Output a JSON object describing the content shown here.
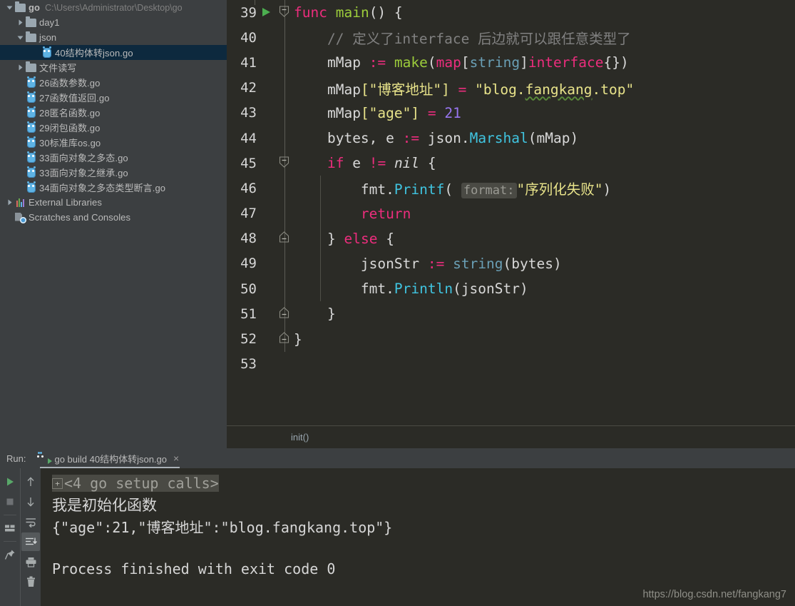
{
  "sidebar": {
    "items": [
      {
        "label": "go",
        "suffix": "C:\\Users\\Administrator\\Desktop\\go",
        "icon": "folder-icon",
        "arrow": "chevron-down-icon",
        "indent": 0,
        "bold": true,
        "selected": false
      },
      {
        "label": "day1",
        "suffix": "",
        "icon": "folder-icon",
        "arrow": "chevron-right-icon",
        "indent": 1,
        "bold": false,
        "selected": false
      },
      {
        "label": "json",
        "suffix": "",
        "icon": "folder-icon",
        "arrow": "chevron-down-icon",
        "indent": 1,
        "bold": false,
        "selected": false
      },
      {
        "label": "40结构体转json.go",
        "suffix": "",
        "icon": "go-file-icon",
        "arrow": "none",
        "indent": 2,
        "bold": false,
        "selected": true
      },
      {
        "label": "文件读写",
        "suffix": "",
        "icon": "folder-icon",
        "arrow": "chevron-right-icon",
        "indent": 1,
        "bold": false,
        "selected": false
      },
      {
        "label": "26函数参数.go",
        "suffix": "",
        "icon": "go-file-icon",
        "arrow": "none",
        "indent": 1,
        "bold": false,
        "selected": false
      },
      {
        "label": "27函数值返回.go",
        "suffix": "",
        "icon": "go-file-icon",
        "arrow": "none",
        "indent": 1,
        "bold": false,
        "selected": false
      },
      {
        "label": "28匿名函数.go",
        "suffix": "",
        "icon": "go-file-icon",
        "arrow": "none",
        "indent": 1,
        "bold": false,
        "selected": false
      },
      {
        "label": "29闭包函数.go",
        "suffix": "",
        "icon": "go-file-icon",
        "arrow": "none",
        "indent": 1,
        "bold": false,
        "selected": false
      },
      {
        "label": "30标准库os.go",
        "suffix": "",
        "icon": "go-file-icon",
        "arrow": "none",
        "indent": 1,
        "bold": false,
        "selected": false
      },
      {
        "label": "33面向对象之多态.go",
        "suffix": "",
        "icon": "go-file-icon",
        "arrow": "none",
        "indent": 1,
        "bold": false,
        "selected": false
      },
      {
        "label": "33面向对象之继承.go",
        "suffix": "",
        "icon": "go-file-icon",
        "arrow": "none",
        "indent": 1,
        "bold": false,
        "selected": false
      },
      {
        "label": "34面向对象之多态类型断言.go",
        "suffix": "",
        "icon": "go-file-icon",
        "arrow": "none",
        "indent": 1,
        "bold": false,
        "selected": false
      },
      {
        "label": "External Libraries",
        "suffix": "",
        "icon": "libraries-icon",
        "arrow": "chevron-right-icon",
        "indent": 0,
        "bold": false,
        "selected": false
      },
      {
        "label": "Scratches and Consoles",
        "suffix": "",
        "icon": "scratches-icon",
        "arrow": "none",
        "indent": 0,
        "bold": false,
        "selected": false
      }
    ]
  },
  "editor": {
    "breadcrumb": "init()",
    "first_line_number": 39,
    "lines": [
      {
        "n": "39",
        "gutter": "run-arrow-and-fold-collapse",
        "indent": 0
      },
      {
        "n": "40",
        "gutter": "none",
        "indent": 1
      },
      {
        "n": "41",
        "gutter": "none",
        "indent": 1
      },
      {
        "n": "42",
        "gutter": "none",
        "indent": 1
      },
      {
        "n": "43",
        "gutter": "none",
        "indent": 1
      },
      {
        "n": "44",
        "gutter": "none",
        "indent": 1
      },
      {
        "n": "45",
        "gutter": "fold-down",
        "indent": 1
      },
      {
        "n": "46",
        "gutter": "none",
        "indent": 2
      },
      {
        "n": "47",
        "gutter": "none",
        "indent": 2
      },
      {
        "n": "48",
        "gutter": "fold-up",
        "indent": 1
      },
      {
        "n": "49",
        "gutter": "none",
        "indent": 2
      },
      {
        "n": "50",
        "gutter": "none",
        "indent": 2
      },
      {
        "n": "51",
        "gutter": "fold-up",
        "indent": 1
      },
      {
        "n": "52",
        "gutter": "fold-up",
        "indent": 0
      },
      {
        "n": "53",
        "gutter": "none",
        "indent": 0
      }
    ],
    "code": {
      "l39_func": "func",
      "l39_name": "main",
      "l39_tail": "() {",
      "l40_comment": "// 定义了interface 后边就可以跟任意类型了",
      "l41_var": "mMap",
      "l41_assign": ":=",
      "l41_make": "make",
      "l41_open": "(",
      "l41_map": "map",
      "l41_lb": "[",
      "l41_string": "string",
      "l41_rb": "]",
      "l41_iface": "interface",
      "l41_close": "{})",
      "l42_var": "mMap",
      "l42_key": "[\"博客地址\"]",
      "l42_eq": "=",
      "l42_val_pre": "\"blog.",
      "l42_val_squig": "fangkang",
      "l42_val_post": ".top\"",
      "l43_var": "mMap",
      "l43_key": "[\"age\"]",
      "l43_eq": "=",
      "l43_num": "21",
      "l44_lhs": "bytes, e",
      "l44_assign": ":=",
      "l44_pkg": "json.",
      "l44_mth": "Marshal",
      "l44_args": "(mMap)",
      "l45_if": "if",
      "l45_var": "e",
      "l45_op": "!=",
      "l45_nil": "nil",
      "l45_brace": "{",
      "l46_pkg": "fmt.",
      "l46_mth": "Printf",
      "l46_open": "(",
      "l46_hint": "format:",
      "l46_str": "\"序列化失败\"",
      "l46_close": ")",
      "l47_return": "return",
      "l48_close": "}",
      "l48_else": "else",
      "l48_brace": "{",
      "l49_var": "jsonStr",
      "l49_assign": ":=",
      "l49_cast": "string",
      "l49_args": "(bytes)",
      "l50_pkg": "fmt.",
      "l50_mth": "Println",
      "l50_args": "(jsonStr)",
      "l51_brace": "}",
      "l52_brace": "}"
    }
  },
  "run_panel": {
    "label": "Run:",
    "tab_title": "go build 40结构体转json.go",
    "close_label": "×",
    "toolbar_primary": [
      {
        "name": "rerun-button",
        "icon": "play-icon"
      },
      {
        "name": "stop-button",
        "icon": "stop-icon"
      },
      {
        "name": "layout-button",
        "icon": "layout-icon"
      },
      {
        "name": "pin-tab-button",
        "icon": "pin-icon"
      }
    ],
    "toolbar_secondary": [
      {
        "name": "up-button",
        "icon": "arrow-up-icon",
        "active": false
      },
      {
        "name": "down-button",
        "icon": "arrow-down-icon",
        "active": false
      },
      {
        "name": "soft-wrap-button",
        "icon": "soft-wrap-icon",
        "active": false
      },
      {
        "name": "scroll-to-end-button",
        "icon": "scroll-to-end-icon",
        "active": true
      },
      {
        "name": "print-button",
        "icon": "printer-icon",
        "active": false
      },
      {
        "name": "clear-all-button",
        "icon": "trash-icon",
        "active": false
      }
    ],
    "console": {
      "folded_label": "<4 go setup calls>",
      "expand_glyph": "+",
      "line_init": "我是初始化函数",
      "line_json": "{\"age\":21,\"博客地址\":\"blog.fangkang.top\"}",
      "line_blank": "",
      "line_finished": "Process finished with exit code 0"
    },
    "watermark": "https://blog.csdn.net/fangkang7"
  },
  "colors": {
    "sidebar_bg": "#3c3f41",
    "editor_bg": "#2b2b26",
    "selection_bg": "#0d293e",
    "accent_green": "#59a869",
    "keyword": "#ec2d7d",
    "function": "#9ccc3b",
    "string": "#e8e38a",
    "number": "#9876f0",
    "comment": "#808080",
    "method": "#40c4e0"
  }
}
